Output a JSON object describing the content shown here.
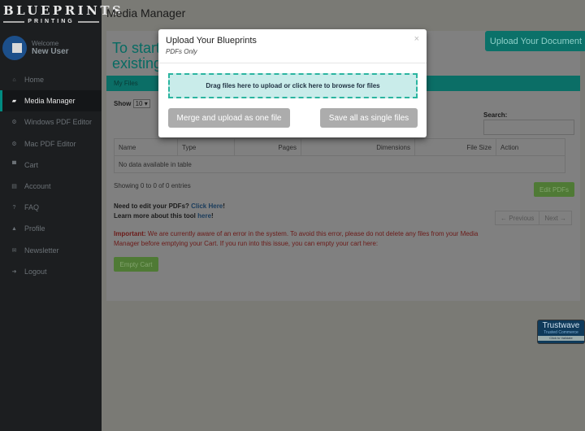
{
  "sidebar": {
    "logo": {
      "line1": "BLUEPRINTS",
      "line2": "PRINTING"
    },
    "welcome": "Welcome",
    "user": "New User",
    "items": [
      {
        "label": "Home",
        "icon": "home-icon",
        "glyph": "⌂"
      },
      {
        "label": "Media Manager",
        "icon": "folder-open-icon",
        "glyph": "▰",
        "active": true
      },
      {
        "label": "Windows PDF Editor",
        "icon": "cogs-icon",
        "glyph": "⚙"
      },
      {
        "label": "Mac PDF Editor",
        "icon": "cogs-icon",
        "glyph": "⚙"
      },
      {
        "label": "Cart",
        "icon": "cart-icon",
        "glyph": "▀"
      },
      {
        "label": "Account",
        "icon": "account-icon",
        "glyph": "▤"
      },
      {
        "label": "FAQ",
        "icon": "question-icon",
        "glyph": "?"
      },
      {
        "label": "Profile",
        "icon": "user-icon",
        "glyph": "▲"
      },
      {
        "label": "Newsletter",
        "icon": "envelope-icon",
        "glyph": "✉"
      },
      {
        "label": "Logout",
        "icon": "sign-out-icon",
        "glyph": "➜"
      }
    ]
  },
  "header": {
    "title": "Media Manager"
  },
  "main": {
    "title_line1": "To start a",
    "title_line2": "existing",
    "upload_button": "Upload Your Document",
    "tab": "My Files",
    "show_label": "Show",
    "page_size": "10 ▾",
    "search_label": "Search:",
    "columns": [
      "Name",
      "Type",
      "Pages",
      "Dimensions",
      "File Size",
      "Action"
    ],
    "empty_text": "No data available in table",
    "showing": "Showing 0 to 0 of 0 entries",
    "edit_button": "Edit PDFs",
    "need_edit": "Need to edit your PDFs? ",
    "click_here": "Click Here",
    "excl": "!",
    "learn_more": "Learn more about this tool ",
    "here": "here",
    "prev": "← Previous",
    "next": "Next →",
    "important_label": "Important:",
    "important_text": " We are currently aware of an error in the system. To avoid this error, please do not delete any files from your Media Manager before emptying your Cart. If you run into this issue, you can empty your cart here:",
    "empty_cart": "Empty Cart"
  },
  "trustwave": {
    "name": "Trustwave",
    "sub": "Trusted Commerce",
    "cta": "Click to Validate"
  },
  "modal": {
    "title": "Upload Your Blueprints",
    "subtitle": "PDFs Only",
    "close": "×",
    "dropzone": "Drag files here to upload or click here to browse for files",
    "merge_button": "Merge and upload as one file",
    "single_button": "Save all as single files"
  },
  "colors": {
    "accent": "#009688",
    "dropzone_bg": "#c9ecea",
    "dropzone_border": "#2bb5a0",
    "important": "#d9534f"
  }
}
